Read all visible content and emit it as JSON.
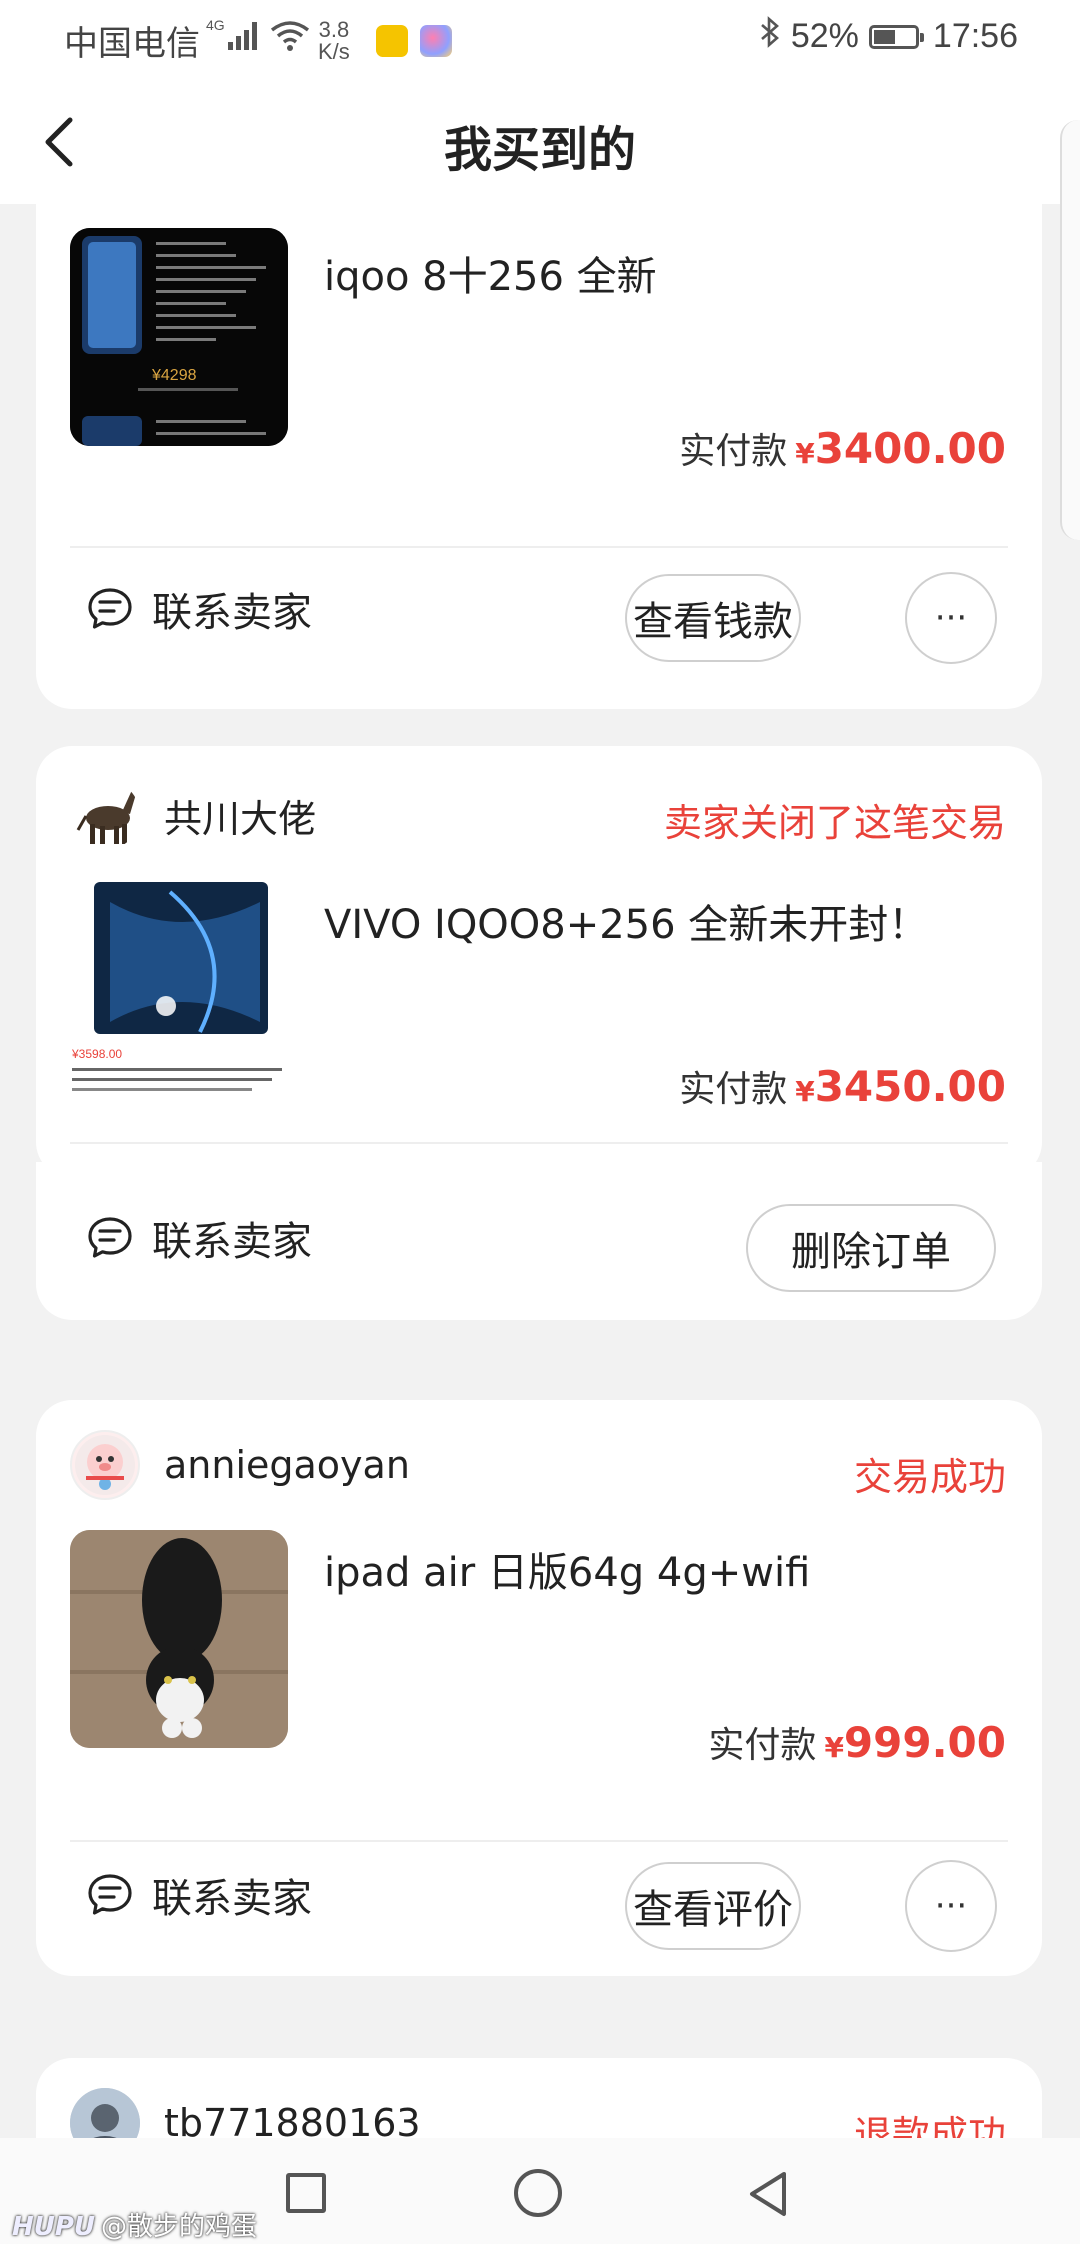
{
  "status_bar": {
    "carrier": "中国电信",
    "network": "4G",
    "speed_value": "3.8",
    "speed_unit": "K/s",
    "battery": "52%",
    "time": "17:56",
    "battery_level": 0.52,
    "icons": [
      "signal-icon",
      "wifi-icon",
      "app-icon",
      "bluetooth-icon",
      "battery-icon"
    ]
  },
  "header": {
    "title": "我买到的"
  },
  "orders": [
    {
      "seller": "",
      "status": "",
      "title": "iqoo 8十256 全新",
      "price_label": "实付款",
      "currency": "¥",
      "price": "3400.00",
      "thumb_text": "¥4298",
      "contact_label": "联系卖家",
      "action_label": "查看钱款",
      "more_label": "···"
    },
    {
      "seller": "共川大佬",
      "status": "卖家关闭了这笔交易",
      "title": "VIVO IQOO8+256 全新未开封！",
      "price_label": "实付款",
      "currency": "¥",
      "price": "3450.00",
      "thumb_price": "¥3598.00",
      "contact_label": "联系卖家",
      "action_label": "删除订单"
    },
    {
      "seller": "anniegaoyan",
      "status": "交易成功",
      "title": "ipad air 日版64g 4g+wifi",
      "price_label": "实付款",
      "currency": "¥",
      "price": "999.00",
      "contact_label": "联系卖家",
      "action_label": "查看评价",
      "more_label": "···"
    },
    {
      "seller": "tb771880163",
      "status": "退款成功"
    }
  ],
  "watermark": {
    "brand": "HUPU",
    "user": "@散步的鸡蛋"
  },
  "colors": {
    "accent": "#e9423a",
    "background": "#f2f2f2"
  }
}
